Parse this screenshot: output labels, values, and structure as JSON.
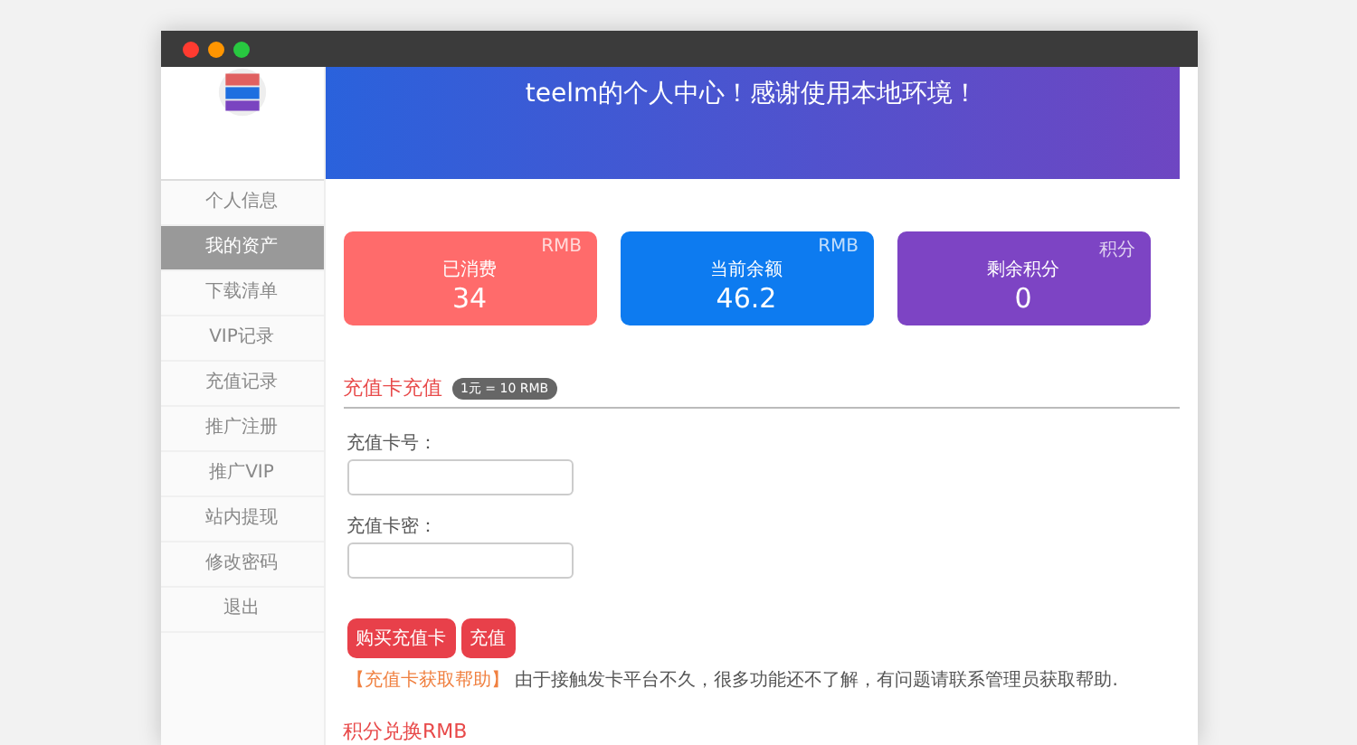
{
  "sidebar": {
    "items": [
      {
        "label": "个人信息",
        "selected": false
      },
      {
        "label": "我的资产",
        "selected": true
      },
      {
        "label": "下载清单",
        "selected": false
      },
      {
        "label": "VIP记录",
        "selected": false
      },
      {
        "label": "充值记录",
        "selected": false
      },
      {
        "label": "推广注册",
        "selected": false
      },
      {
        "label": "推广VIP",
        "selected": false
      },
      {
        "label": "站内提现",
        "selected": false
      },
      {
        "label": "修改密码",
        "selected": false
      },
      {
        "label": "退出",
        "selected": false
      }
    ]
  },
  "header": {
    "title": "teelm的个人中心！感谢使用本地环境！"
  },
  "cards": [
    {
      "label": "已消费",
      "unit": "RMB",
      "value": "34",
      "color": "#ff6b6b"
    },
    {
      "label": "当前余额",
      "unit": "RMB",
      "value": "46.2",
      "color": "#0d7bf0"
    },
    {
      "label": "剩余积分",
      "unit": "积分",
      "value": "0",
      "color": "#7d44c4"
    }
  ],
  "recharge": {
    "title": "充值卡充值",
    "badge": "1元 = 10 RMB",
    "fields": [
      {
        "label": "充值卡号："
      },
      {
        "label": "充值卡密："
      }
    ],
    "buttons": [
      "购买充值卡",
      "充值"
    ],
    "help_link": "【充值卡获取帮助】",
    "help_text": "由于接触发卡平台不久，很多功能还不了解，有问题请联系管理员获取帮助."
  },
  "exchange": {
    "title": "积分兑换RMB"
  }
}
